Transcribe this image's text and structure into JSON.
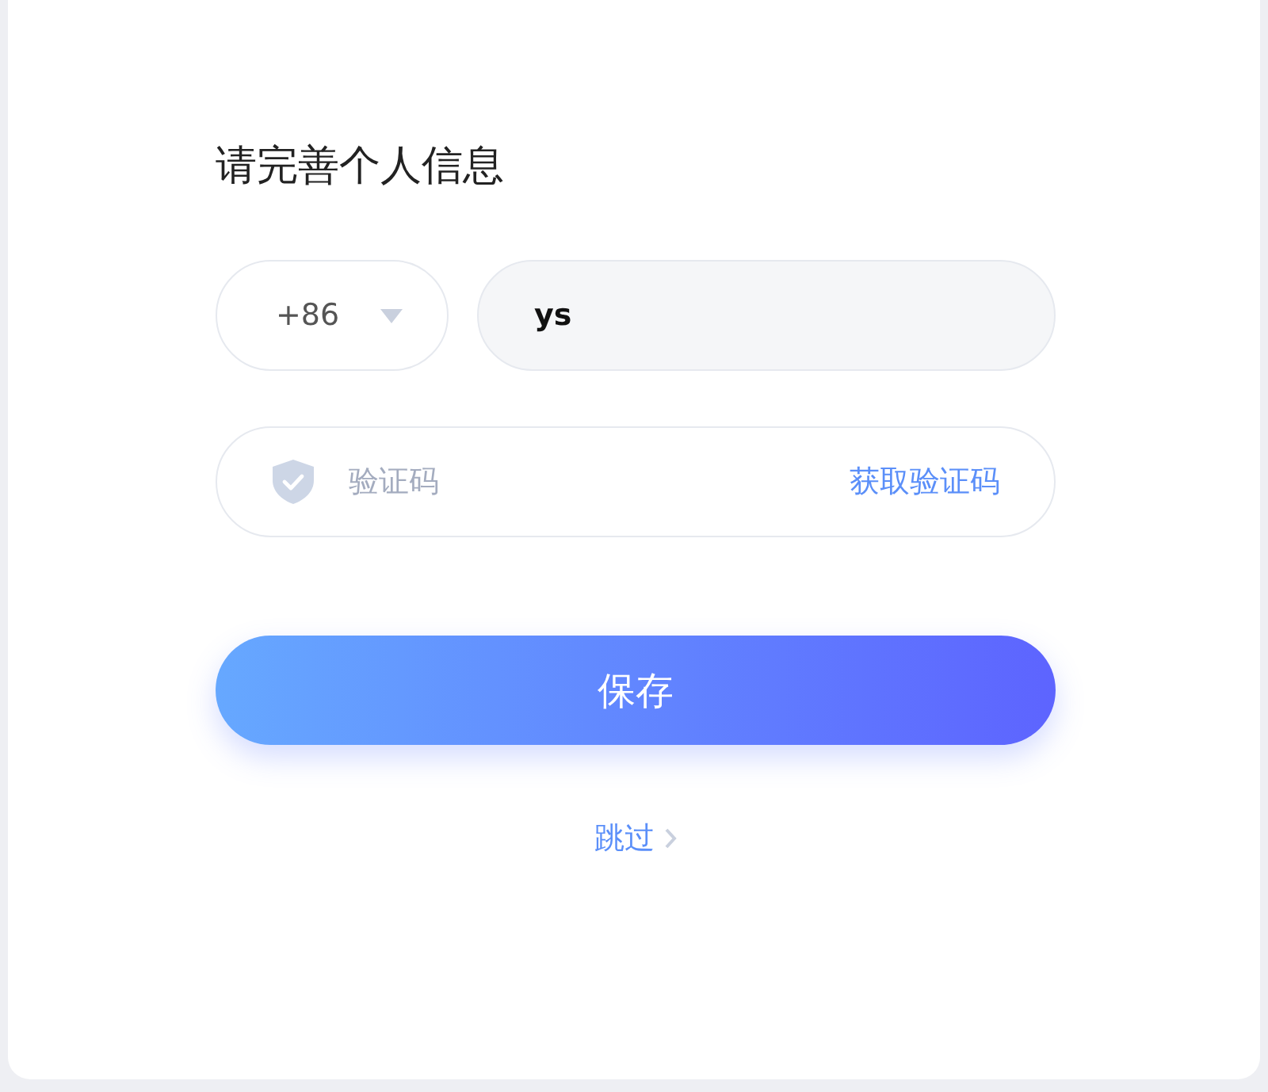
{
  "title": "请完善个人信息",
  "country_code": {
    "value": "+86"
  },
  "phone": {
    "value": "ys"
  },
  "code": {
    "placeholder": "验证码",
    "action": "获取验证码"
  },
  "save_button": "保存",
  "skip_link": "跳过"
}
